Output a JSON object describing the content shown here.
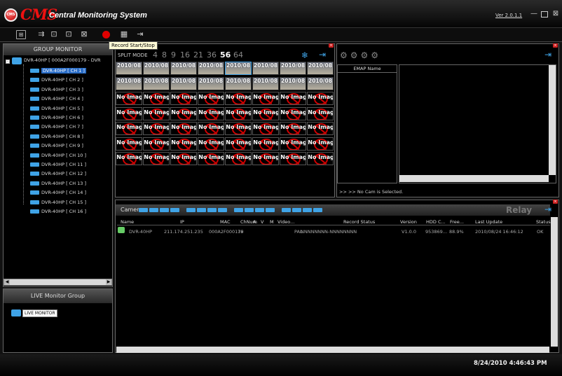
{
  "app": {
    "logo_badge": "CMS",
    "logo_text": "CMS",
    "title": "Central Monitoring System",
    "version": "Ver 2.0.1.1"
  },
  "toolbar": {
    "tooltip": "Record Start/Stop"
  },
  "group_monitor": {
    "title": "GROUP MONITOR",
    "root": "DVR-40HP [ 000A2F000179 - DVR",
    "channels": [
      "DVR-40HP [ CH 1 ]",
      "DVR-40HP [ CH 2 ]",
      "DVR-40HP [ CH 3 ]",
      "DVR-40HP [ CH 4 ]",
      "DVR-40HP [ CH 5 ]",
      "DVR-40HP [ CH 6 ]",
      "DVR-40HP [ CH 7 ]",
      "DVR-40HP [ CH 8 ]",
      "DVR-40HP [ CH 9 ]",
      "DVR-40HP [ CH 10 ]",
      "DVR-40HP [ CH 11 ]",
      "DVR-40HP [ CH 12 ]",
      "DVR-40HP [ CH 13 ]",
      "DVR-40HP [ CH 14 ]",
      "DVR-40HP [ CH 15 ]",
      "DVR-40HP [ CH 16 ]"
    ],
    "selected_index": 0
  },
  "live_group": {
    "title": "LIVE Monitor Group",
    "item": "LIVE MONITOR"
  },
  "split": {
    "label": "SPLIT MODE",
    "modes": [
      "4",
      "8",
      "9",
      "16",
      "21",
      "36",
      "56",
      "64"
    ],
    "active": "56"
  },
  "grid": {
    "live_label": "2010/08",
    "noimg_label": "No Imag"
  },
  "emap": {
    "column": "EMAP Name",
    "status": ">> >> No Cam is Selected."
  },
  "relay": {
    "camera_label": "Camera",
    "relay_label": "Relay"
  },
  "table": {
    "headers": [
      "Name",
      "IP",
      "MAC",
      "ChNum",
      "A",
      "V",
      "M",
      "Video...",
      "Record Status",
      "Version",
      "HDD C...",
      "Free...",
      "Last Update",
      "Status"
    ],
    "rows": [
      [
        "DVR-40HP",
        "211.174.251.235",
        "000A2F000179",
        "16",
        "",
        "",
        "",
        "PAL",
        "NNNNNNNN-NNNNNNNN",
        "V1.0.0",
        "953869...",
        "88.9%",
        "2010/08/24 16:46:12",
        "OK"
      ]
    ]
  },
  "statusbar": {
    "datetime": "8/24/2010 4:46:43 PM"
  },
  "colors": {
    "accent_blue": "#2a6dc7",
    "record_red": "#e00000",
    "camera_blue": "#3fa3e6"
  }
}
